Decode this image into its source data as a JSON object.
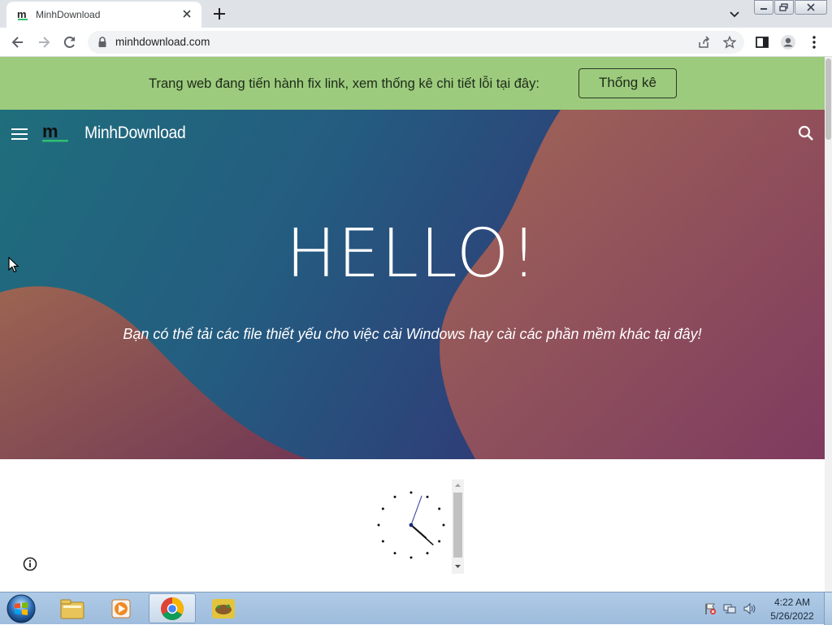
{
  "browser": {
    "tab_title": "MinhDownload",
    "url": "minhdownload.com"
  },
  "page": {
    "notice_text": "Trang web đang tiến hành fix link, xem thống kê chi tiết lỗi tại đây:",
    "notice_button": "Thống kê",
    "brand": "MinhDownload",
    "hero_title": "HELLO!",
    "hero_subtitle": "Bạn có thể tải các file thiết yếu cho việc cài Windows hay cài các phần mềm khác tại đây!",
    "colors": {
      "notice_bg": "#9ccb7d",
      "logo_accent": "#2fbf71"
    }
  },
  "clock": {
    "hour": 4,
    "minute": 22
  },
  "taskbar": {
    "items": [
      "file-explorer-icon",
      "media-player-icon",
      "chrome-icon",
      "app-icon"
    ],
    "time": "4:22 AM",
    "date": "5/26/2022"
  }
}
